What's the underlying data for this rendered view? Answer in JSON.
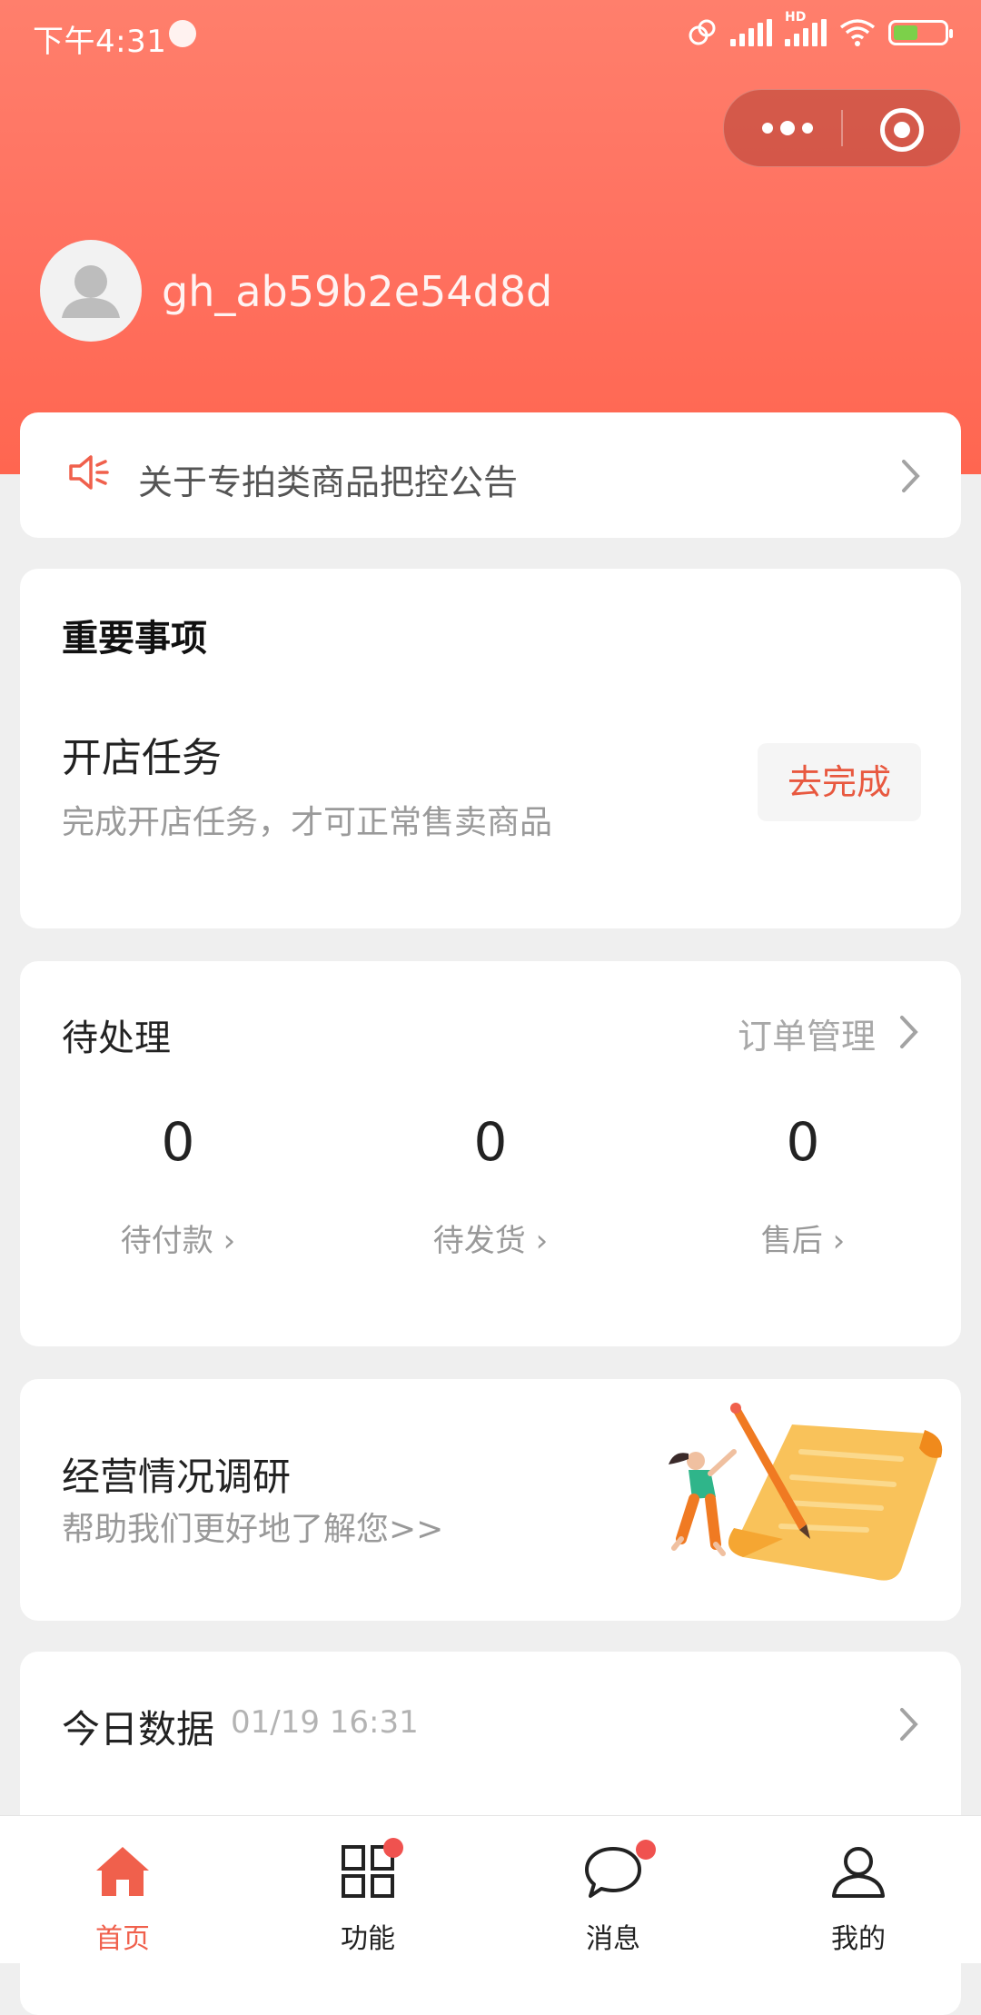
{
  "status_bar": {
    "time": "下午4:31",
    "hd_label": "HD"
  },
  "header": {
    "username": "gh_ab59b2e54d8d"
  },
  "notice": {
    "text": "关于专拍类商品把控公告"
  },
  "important": {
    "title": "重要事项",
    "task_title": "开店任务",
    "task_desc": "完成开店任务，才可正常售卖商品",
    "button_label": "去完成"
  },
  "pending": {
    "title": "待处理",
    "link_label": "订单管理",
    "stats": [
      {
        "value": "0",
        "label": "待付款"
      },
      {
        "value": "0",
        "label": "待发货"
      },
      {
        "value": "0",
        "label": "售后"
      }
    ]
  },
  "survey": {
    "title": "经营情况调研",
    "subtitle": "帮助我们更好地了解您>>"
  },
  "today": {
    "title": "今日数据",
    "time": "01/19 16:31"
  },
  "tabbar": {
    "items": [
      {
        "label": "首页",
        "icon": "home-icon",
        "active": true
      },
      {
        "label": "功能",
        "icon": "grid-icon",
        "badge": true
      },
      {
        "label": "消息",
        "icon": "chat-bubble-icon",
        "badge": true
      },
      {
        "label": "我的",
        "icon": "person-icon"
      }
    ]
  },
  "colors": {
    "header_gradient": "#ff7f6c",
    "accent": "#f0604c",
    "badge": "#f0524f"
  }
}
